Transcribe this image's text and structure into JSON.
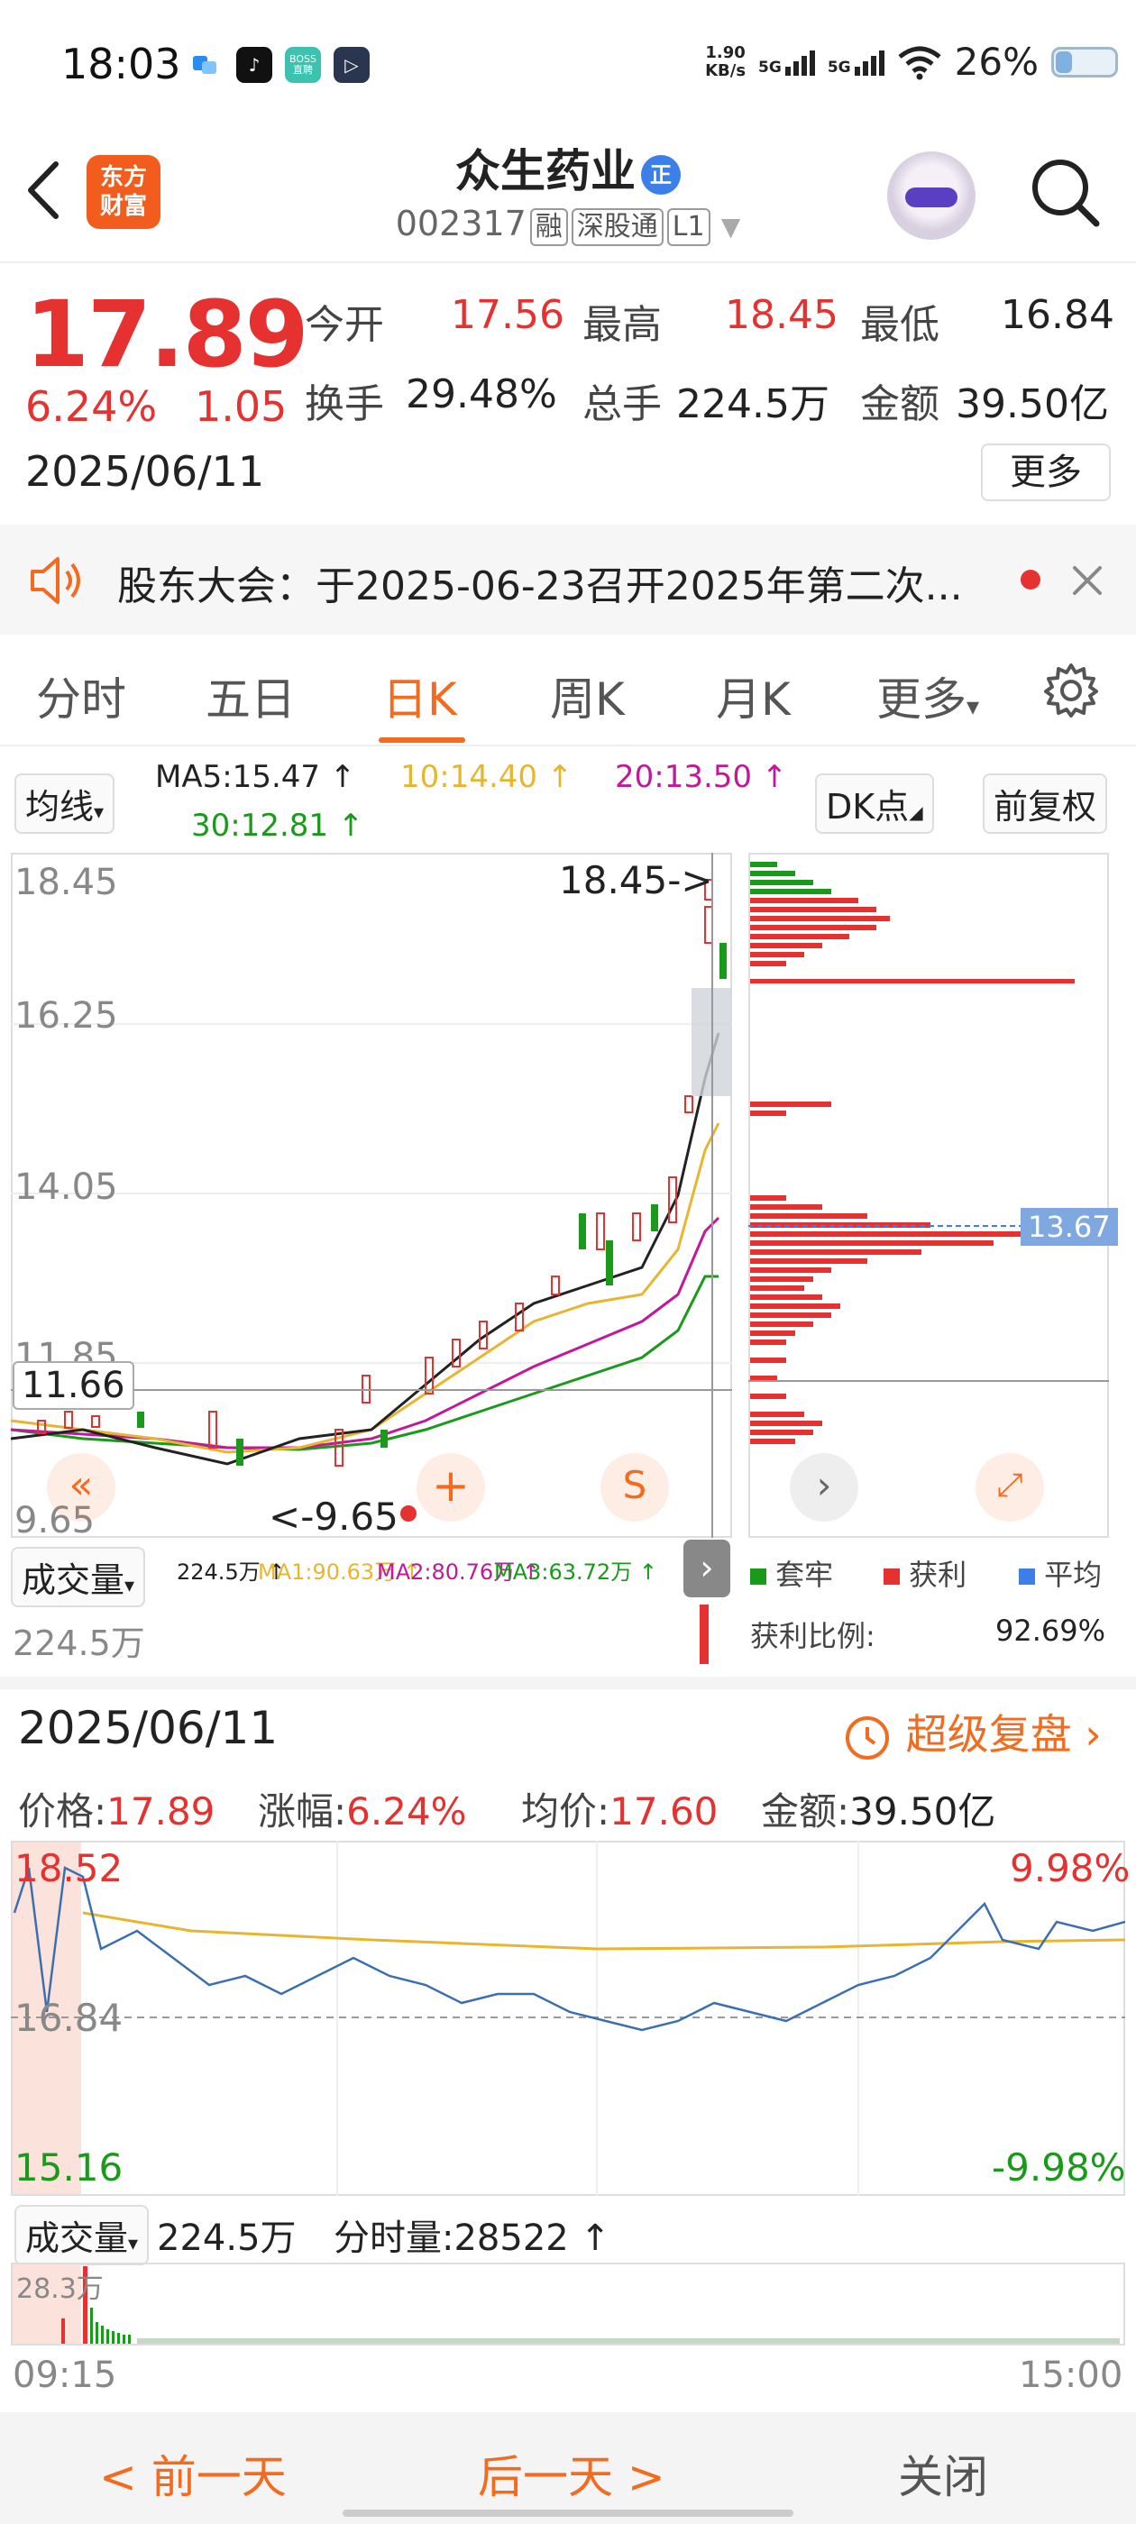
{
  "status_bar": {
    "time": "18:03",
    "net_speed_value": "1.90",
    "net_speed_unit": "KB/s",
    "signal1": "5G",
    "signal2": "5G",
    "battery": "26%",
    "app_icons": [
      "bubble-app-icon",
      "tiktok-icon",
      "boss-icon",
      "player-icon"
    ],
    "boss_label": "BOSS直聘"
  },
  "header": {
    "logo_line1": "东方",
    "logo_line2": "财富",
    "stock_name": "众生药业",
    "badge": "正",
    "code": "002317",
    "tag1": "融",
    "tag2": "深股通",
    "tag3": "L1"
  },
  "quote": {
    "price": "17.89",
    "change_pct": "6.24%",
    "change": "1.05",
    "date": "2025/06/11",
    "open_label": "今开",
    "open": "17.56",
    "high_label": "最高",
    "high": "18.45",
    "low_label": "最低",
    "low": "16.84",
    "turnover_label": "换手",
    "turnover": "29.48%",
    "volume_label": "总手",
    "volume": "224.5万",
    "amount_label": "金额",
    "amount": "39.50亿",
    "more": "更多"
  },
  "notice": {
    "text": "股东大会：于2025-06-23召开2025年第二次..."
  },
  "tabs": [
    "分时",
    "五日",
    "日K",
    "周K",
    "月K",
    "更多"
  ],
  "active_tab": "日K",
  "kline": {
    "ma_select": "均线",
    "ma5": "MA5:15.47 ↑",
    "ma10": "10:14.40 ↑",
    "ma20": "20:13.50 ↑",
    "ma30": "30:12.81 ↑",
    "dk_label": "DK点",
    "adjust_label": "前复权",
    "y_labels": [
      "18.45",
      "16.25",
      "14.05",
      "11.85",
      "9.65"
    ],
    "crosshair_price": "11.66",
    "high_marker": "18.45->",
    "low_marker": "<-9.65",
    "volume_select": "成交量",
    "vol_value": "224.5万 ↑",
    "vol_ma1": "MA1:90.63万 ↑",
    "vol_ma2": "MA2:80.76万 ↑",
    "vol_ma3": "MA3:63.72万 ↑",
    "vol_axis": "224.5万",
    "chip_avg": "13.67",
    "legend_trapped": "套牢",
    "legend_profit": "获利",
    "legend_avg": "平均",
    "profit_ratio_label": "获利比例:",
    "profit_ratio": "92.69%"
  },
  "colors": {
    "up": "#e5312f",
    "down": "#1a9a1a",
    "accent": "#f26b1f",
    "ma5": "#222222",
    "ma10": "#e8b530",
    "ma20": "#c2189a",
    "ma30": "#1a9a1a"
  },
  "intraday": {
    "date": "2025/06/11",
    "replay_label": "超级复盘",
    "price_label": "价格:",
    "price": "17.89",
    "pct_label": "涨幅:",
    "pct": "6.24%",
    "avg_label": "均价:",
    "avg": "17.60",
    "amount_label": "金额:",
    "amount": "39.50亿",
    "y_top": "18.52",
    "y_mid": "16.84",
    "y_bot": "15.16",
    "pct_top": "9.98%",
    "pct_bot": "-9.98%",
    "vol_select": "成交量",
    "vol_value": "224.5万",
    "tick_vol": "分时量:28522 ↑",
    "vol_axis": "28.3万",
    "time_start": "09:15",
    "time_end": "15:00"
  },
  "bottom_nav": {
    "prev": "< 前一天",
    "next": "后一天 >",
    "close": "关闭"
  }
}
